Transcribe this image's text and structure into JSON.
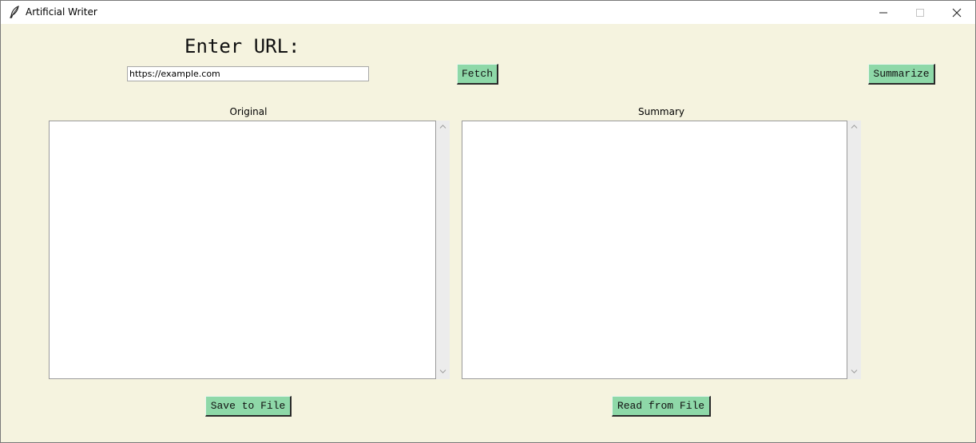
{
  "window": {
    "title": "Artificial Writer",
    "app_icon": "feather-icon",
    "controls": {
      "minimize_icon": "minimize-icon",
      "maximize_icon": "maximize-icon",
      "close_icon": "close-icon"
    }
  },
  "url_section": {
    "heading": "Enter URL:",
    "url_value": "https://example.com",
    "fetch_label": "Fetch",
    "summarize_label": "Summarize"
  },
  "panes": {
    "original": {
      "label": "Original",
      "text": ""
    },
    "summary": {
      "label": "Summary",
      "text": ""
    }
  },
  "footer": {
    "save_label": "Save to File",
    "read_label": "Read from File"
  },
  "colors": {
    "window_bg": "#f5f3df",
    "button_bg": "#8ed8a8",
    "titlebar_bg": "#ffffff"
  }
}
